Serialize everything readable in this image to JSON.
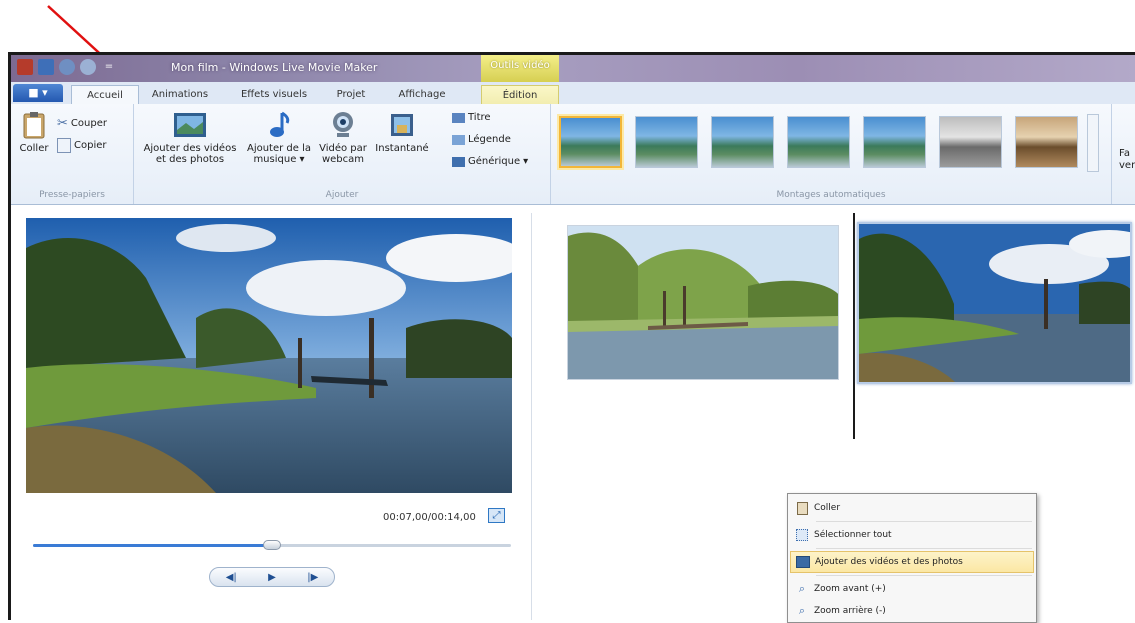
{
  "window": {
    "title": "Mon film - Windows Live Movie Maker",
    "context_tab_group": "Outils vidéo"
  },
  "tabs": [
    {
      "label": "Accueil",
      "active": true
    },
    {
      "label": "Animations"
    },
    {
      "label": "Effets visuels"
    },
    {
      "label": "Projet"
    },
    {
      "label": "Affichage"
    },
    {
      "label": "Édition",
      "context": true
    }
  ],
  "ribbon": {
    "clipboard": {
      "group_label": "Presse-papiers",
      "paste": "Coller",
      "cut": "Couper",
      "copy": "Copier"
    },
    "add": {
      "group_label": "Ajouter",
      "add_videos_photos": "Ajouter des vidéos et des photos",
      "add_music": "Ajouter de la musique",
      "add_music_arrow": "▾",
      "webcam_video": "Vidéo par webcam",
      "snapshot": "Instantané",
      "title": "Titre",
      "caption": "Légende",
      "credits": "Générique",
      "credits_arrow": "▾"
    },
    "automovies": {
      "group_label": "Montages automatiques",
      "themes_count": 7
    },
    "truncated_right": "Fa",
    "truncated_right_2": "ver"
  },
  "preview": {
    "timecode": "00:07,00/00:14,00",
    "progress": 0.5
  },
  "context_menu": {
    "items": [
      {
        "label": "Coller",
        "icon": "paste-icon"
      },
      {
        "label": "Sélectionner tout",
        "icon": "select-all-icon"
      },
      {
        "label": "Ajouter des vidéos et des photos",
        "icon": "add-media-icon",
        "highlighted": true
      },
      {
        "label": "Zoom avant (+)",
        "icon": "zoom-in-icon"
      },
      {
        "label": "Zoom arrière (-)",
        "icon": "zoom-out-icon"
      }
    ]
  },
  "colors": {
    "accent": "#3a7bd5",
    "arrow": "#e01010",
    "highlight": "#fbe7a4",
    "selected_theme": "#f2b638"
  }
}
